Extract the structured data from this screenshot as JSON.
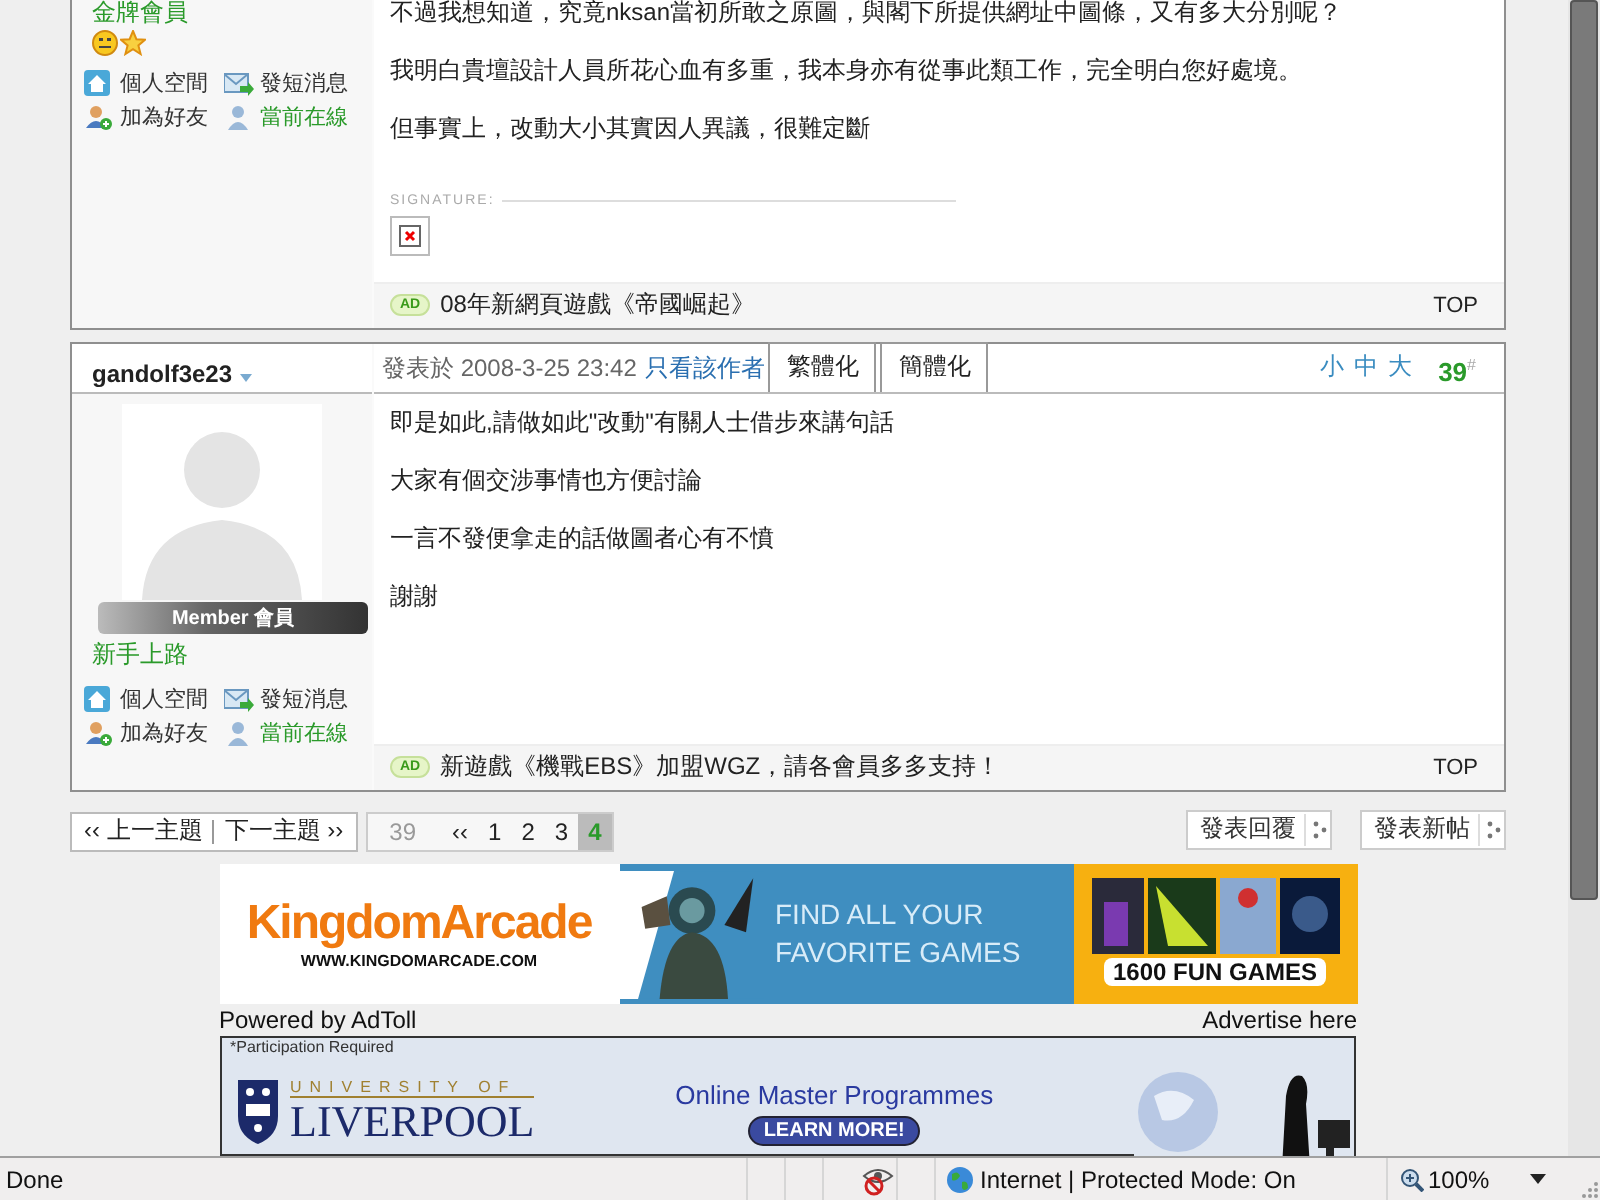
{
  "posts": [
    {
      "sidebar": {
        "rank": "金牌會員",
        "rank_icons": [
          {
            "kind": "smiley"
          },
          {
            "kind": "star"
          }
        ],
        "links": [
          {
            "label": "個人空間",
            "kind": "space"
          },
          {
            "label": "發短消息",
            "kind": "message"
          },
          {
            "label": "加為好友",
            "kind": "friend"
          },
          {
            "label": "當前在線",
            "kind": "online"
          }
        ]
      },
      "lines": [
        "不過我想知道，究竟nksan當初所敢之原圖，與閣下所提供網址中圖條，又有多大分別呢？",
        "我明白貴壇設計人員所花心血有多重，我本身亦有從事此類工作，完全明白您好處境。",
        "但事實上，改動大小其實因人異議，很難定斷"
      ],
      "signature": {
        "label": "SIGNATURE:"
      },
      "footer": {
        "badge": "AD",
        "text": "08年新網頁遊戲《帝國崛起》",
        "top": "TOP"
      }
    },
    {
      "author": "gandolf3e23",
      "header": {
        "posted": "發表於 2008-3-25 23:42",
        "only_author": "只看該作者",
        "tabs": [
          "繁體化",
          "簡體化"
        ],
        "sizes": [
          "小",
          "中",
          "大"
        ],
        "floor": "39",
        "floor_mark": "#"
      },
      "sidebar": {
        "avatar": {
          "kind": "silhouette"
        },
        "badge": "Member 會員",
        "rank": "新手上路",
        "links": [
          {
            "label": "個人空間",
            "kind": "space"
          },
          {
            "label": "發短消息",
            "kind": "message"
          },
          {
            "label": "加為好友",
            "kind": "friend"
          },
          {
            "label": "當前在線",
            "kind": "online"
          }
        ]
      },
      "lines": [
        "即是如此,請做如此\"改動\"有關人士借步來講句話",
        "大家有個交涉事情也方便討論",
        "一言不發便拿走的話做圖者心有不憤",
        "謝謝"
      ],
      "footer": {
        "badge": "AD",
        "text": "新遊戲《機戰EBS》加盟WGZ，請各會員多多支持！",
        "top": "TOP"
      }
    }
  ],
  "nav": {
    "prev": "‹‹ 上一主題",
    "next": "下一主題 ››"
  },
  "pager": [
    {
      "label": "39",
      "kind": "total",
      "selected": false
    },
    {
      "label": "‹‹",
      "kind": "link",
      "selected": false
    },
    {
      "label": "1",
      "kind": "link",
      "selected": false
    },
    {
      "label": "2",
      "kind": "link",
      "selected": false
    },
    {
      "label": "3",
      "kind": "link",
      "selected": false
    },
    {
      "label": "4",
      "kind": "link",
      "selected": true
    }
  ],
  "actions": [
    "發表回覆",
    "發表新帖"
  ],
  "ads": [
    {
      "kind": "arcade",
      "logo": "KingdomArcade",
      "url": "WWW.KINGDOMARCADE.COM",
      "slogan": [
        "FIND ALL YOUR",
        "FAVORITE GAMES"
      ],
      "badge": "1600 FUN GAMES"
    },
    {
      "kind": "credits",
      "powered": "Powered by AdToll",
      "advertise": "Advertise here"
    },
    {
      "kind": "university",
      "note": "*Participation Required",
      "pre": "UNIVERSITY OF",
      "name": "LIVERPOOL",
      "headline": "Online Master Programmes",
      "cta": "LEARN MORE!"
    }
  ],
  "status_bar": {
    "text": "Done",
    "zone": "Internet | Protected Mode: On",
    "zoom": "100%"
  }
}
